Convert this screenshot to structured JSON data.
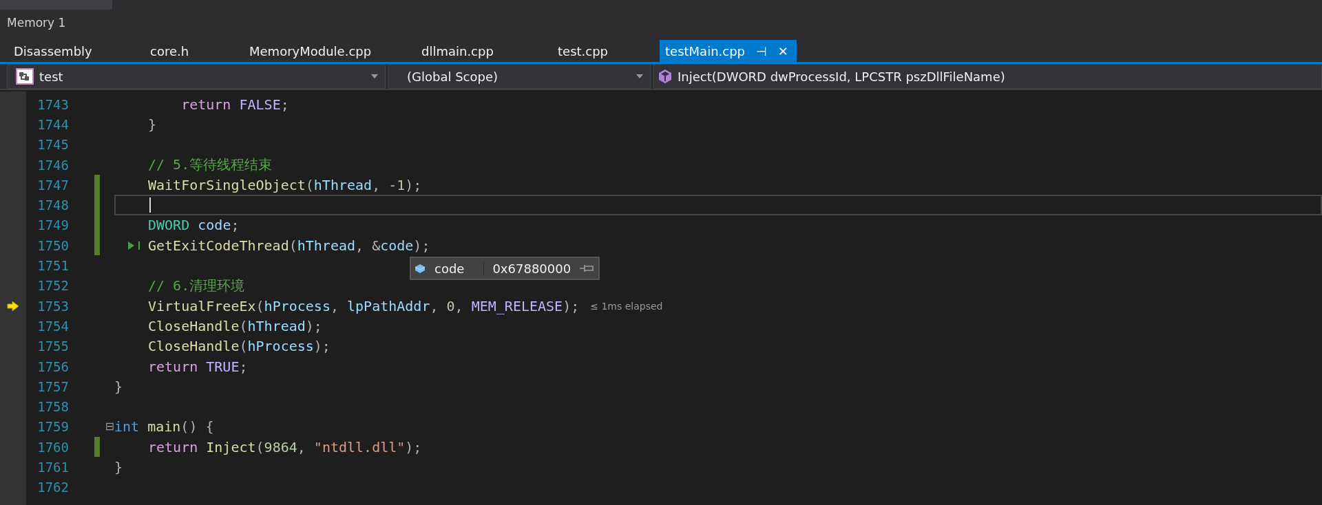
{
  "panel": {
    "title": "Memory 1"
  },
  "tabs": [
    {
      "label": "Disassembly",
      "selected": false
    },
    {
      "label": "core.h",
      "selected": false
    },
    {
      "label": "MemoryModule.cpp",
      "selected": false
    },
    {
      "label": "dllmain.cpp",
      "selected": false
    },
    {
      "label": "test.cpp",
      "selected": false
    },
    {
      "label": "testMain.cpp",
      "selected": true,
      "pin": "⊣",
      "close": "✕"
    }
  ],
  "navigation": {
    "project": "test",
    "scope": "(Global Scope)",
    "member": "Inject(DWORD dwProcessId, LPCSTR pszDllFileName)"
  },
  "lines": [
    {
      "number": "1743",
      "changed": false,
      "tokens": [
        {
          "text": "    return",
          "kind": "keyword"
        },
        {
          "text": " FALSE",
          "kind": "macro"
        },
        {
          "text": ";",
          "kind": "plain"
        }
      ]
    },
    {
      "number": "1744",
      "changed": false,
      "tokens": [
        {
          "text": "}",
          "kind": "plain"
        }
      ]
    },
    {
      "number": "1745",
      "changed": false
    },
    {
      "number": "1746",
      "changed": false,
      "tokens": [
        {
          "text": "// 5.等待线程结束",
          "kind": "comment"
        }
      ]
    },
    {
      "number": "1747",
      "changed": true,
      "tokens": [
        {
          "text": "WaitForSingleObject",
          "kind": "function"
        },
        {
          "text": "(",
          "kind": "plain"
        },
        {
          "text": "hThread",
          "kind": "variable"
        },
        {
          "text": ", ",
          "kind": "plain"
        },
        {
          "text": "-1",
          "kind": "number"
        },
        {
          "text": ");",
          "kind": "plain"
        }
      ]
    },
    {
      "number": "1748",
      "changed": true,
      "current": true
    },
    {
      "number": "1749",
      "changed": true,
      "tokens": [
        {
          "text": "DWORD",
          "kind": "type"
        },
        {
          "text": " code",
          "kind": "variable"
        },
        {
          "text": ";",
          "kind": "plain"
        }
      ]
    },
    {
      "number": "1750",
      "changed": true,
      "run_to_click": true,
      "tokens": [
        {
          "text": "GetExitCodeThread",
          "kind": "function"
        },
        {
          "text": "(",
          "kind": "plain"
        },
        {
          "text": "hThread",
          "kind": "variable"
        },
        {
          "text": ", &",
          "kind": "plain"
        },
        {
          "text": "code",
          "kind": "variable"
        },
        {
          "text": ");",
          "kind": "plain"
        }
      ]
    },
    {
      "number": "1751",
      "changed": false
    },
    {
      "number": "1752",
      "changed": false,
      "tokens": [
        {
          "text": "// 6.清理环境",
          "kind": "comment"
        }
      ]
    },
    {
      "number": "1753",
      "changed": false,
      "execution_point": true,
      "hint": "≤ 1ms elapsed",
      "tokens": [
        {
          "text": "VirtualFreeEx",
          "kind": "function"
        },
        {
          "text": "(",
          "kind": "plain"
        },
        {
          "text": "hProcess",
          "kind": "variable"
        },
        {
          "text": ", ",
          "kind": "plain"
        },
        {
          "text": "lpPathAddr",
          "kind": "variable"
        },
        {
          "text": ", ",
          "kind": "plain"
        },
        {
          "text": "0",
          "kind": "number"
        },
        {
          "text": ", ",
          "kind": "plain"
        },
        {
          "text": "MEM_RELEASE",
          "kind": "macro"
        },
        {
          "text": ");",
          "kind": "plain"
        }
      ]
    },
    {
      "number": "1754",
      "changed": false,
      "tokens": [
        {
          "text": "CloseHandle",
          "kind": "function"
        },
        {
          "text": "(",
          "kind": "plain"
        },
        {
          "text": "hThread",
          "kind": "variable"
        },
        {
          "text": ");",
          "kind": "plain"
        }
      ]
    },
    {
      "number": "1755",
      "changed": false,
      "tokens": [
        {
          "text": "CloseHandle",
          "kind": "function"
        },
        {
          "text": "(",
          "kind": "plain"
        },
        {
          "text": "hProcess",
          "kind": "variable"
        },
        {
          "text": ");",
          "kind": "plain"
        }
      ]
    },
    {
      "number": "1756",
      "changed": false,
      "tokens": [
        {
          "text": "return",
          "kind": "keyword"
        },
        {
          "text": " TRUE",
          "kind": "macro"
        },
        {
          "text": ";",
          "kind": "plain"
        }
      ]
    },
    {
      "number": "1757",
      "changed": false,
      "tokens": [
        {
          "text": "}",
          "kind": "plain"
        }
      ]
    },
    {
      "number": "1758",
      "changed": false
    },
    {
      "number": "1759",
      "changed": false,
      "fold": "⊟",
      "tokens": [
        {
          "text": "int",
          "kind": "builtin"
        },
        {
          "text": " main",
          "kind": "function"
        },
        {
          "text": "() {",
          "kind": "plain"
        }
      ]
    },
    {
      "number": "1760",
      "changed": true,
      "tokens": [
        {
          "text": "return",
          "kind": "keyword"
        },
        {
          "text": " Inject",
          "kind": "function"
        },
        {
          "text": "(",
          "kind": "plain"
        },
        {
          "text": "9864",
          "kind": "number"
        },
        {
          "text": ", ",
          "kind": "plain"
        },
        {
          "text": "\"ntdll.dll\"",
          "kind": "string"
        },
        {
          "text": ");",
          "kind": "plain"
        }
      ]
    },
    {
      "number": "1761",
      "changed": false,
      "tokens": [
        {
          "text": "}",
          "kind": "plain"
        }
      ]
    },
    {
      "number": "1762",
      "changed": false
    }
  ],
  "datatip": {
    "name": "code",
    "value": "0x67880000"
  }
}
